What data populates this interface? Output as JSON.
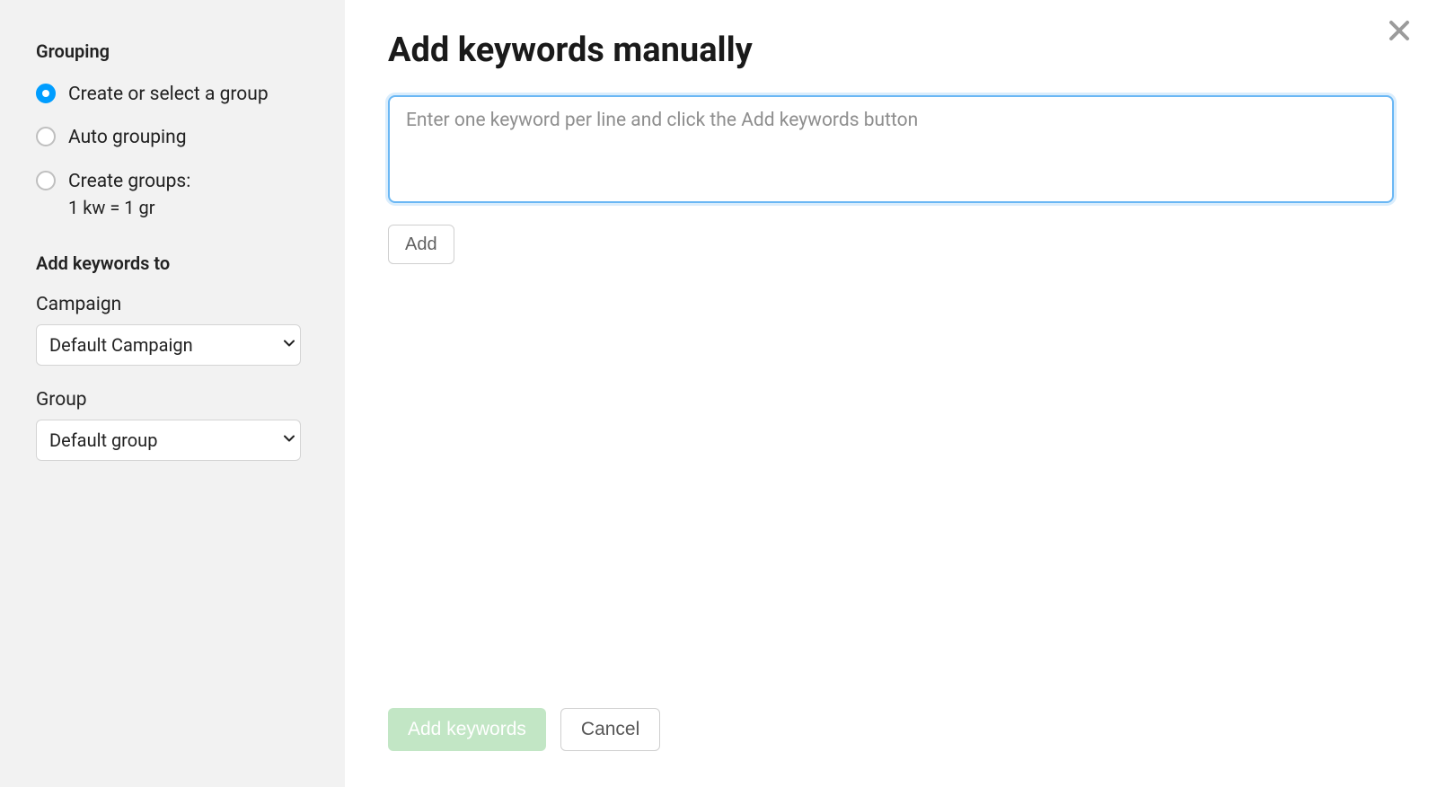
{
  "sidebar": {
    "grouping_heading": "Grouping",
    "options": [
      {
        "label": "Create or select a group",
        "sub": "",
        "selected": true
      },
      {
        "label": "Auto grouping",
        "sub": "",
        "selected": false
      },
      {
        "label": "Create groups:",
        "sub": "1 kw = 1 gr",
        "selected": false
      }
    ],
    "add_to_heading": "Add keywords to",
    "campaign_label": "Campaign",
    "campaign_value": "Default Campaign",
    "group_label": "Group",
    "group_value": "Default group"
  },
  "main": {
    "title": "Add keywords manually",
    "textarea_placeholder": "Enter one keyword per line and click the Add keywords button",
    "add_label": "Add",
    "submit_label": "Add keywords",
    "cancel_label": "Cancel"
  }
}
